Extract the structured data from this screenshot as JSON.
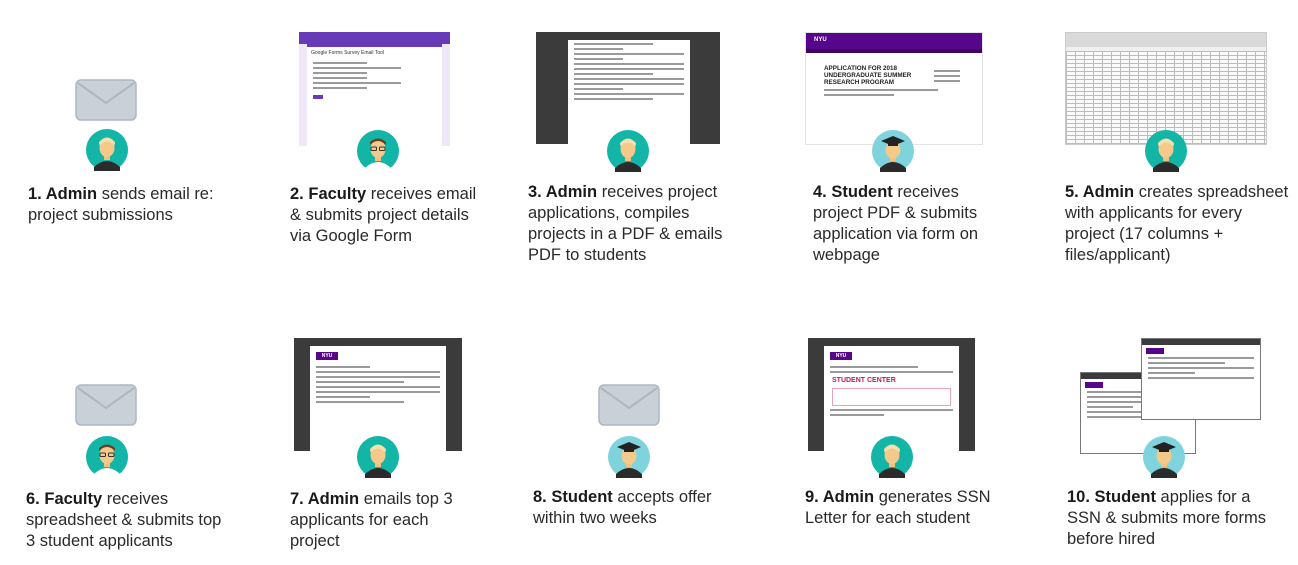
{
  "steps": [
    {
      "num": "1.",
      "actor": "Admin",
      "text": "sends email re: project submissions"
    },
    {
      "num": "2.",
      "actor": "Faculty",
      "text": "receives email & submits project details via Google Form"
    },
    {
      "num": "3.",
      "actor": "Admin",
      "text": "receives project applications, compiles projects in a PDF & emails PDF to students"
    },
    {
      "num": "4.",
      "actor": "Student",
      "text": "receives project PDF & submits application via form on webpage"
    },
    {
      "num": "5.",
      "actor": "Admin",
      "text": "creates spreadsheet with applicants for every project (17 columns + files/applicant)"
    },
    {
      "num": "6.",
      "actor": "Faculty",
      "text": "receives spreadsheet & submits top 3 student applicants"
    },
    {
      "num": "7.",
      "actor": "Admin",
      "text": "emails top 3 applicants for each project"
    },
    {
      "num": "8.",
      "actor": "Student",
      "text": "accepts offer within two weeks"
    },
    {
      "num": "9.",
      "actor": "Admin",
      "text": "generates SSN Letter for each student"
    },
    {
      "num": "10.",
      "actor": "Student",
      "text": "applies for a SSN & submits more forms before hired"
    }
  ],
  "thumbs": {
    "form_title": "Google Forms Survey Email Tool",
    "nyu": "NYU",
    "application_heading": "APPLICATION FOR 2018 UNDERGRADUATE SUMMER RESEARCH PROGRAM",
    "student_center": "STUDENT CENTER"
  },
  "colors": {
    "teal": "#13b5a7",
    "purple": "#673ab7",
    "nyu_purple": "#57068c",
    "envelope": "#bcc5cf",
    "dark_frame": "#3b3b3b"
  }
}
